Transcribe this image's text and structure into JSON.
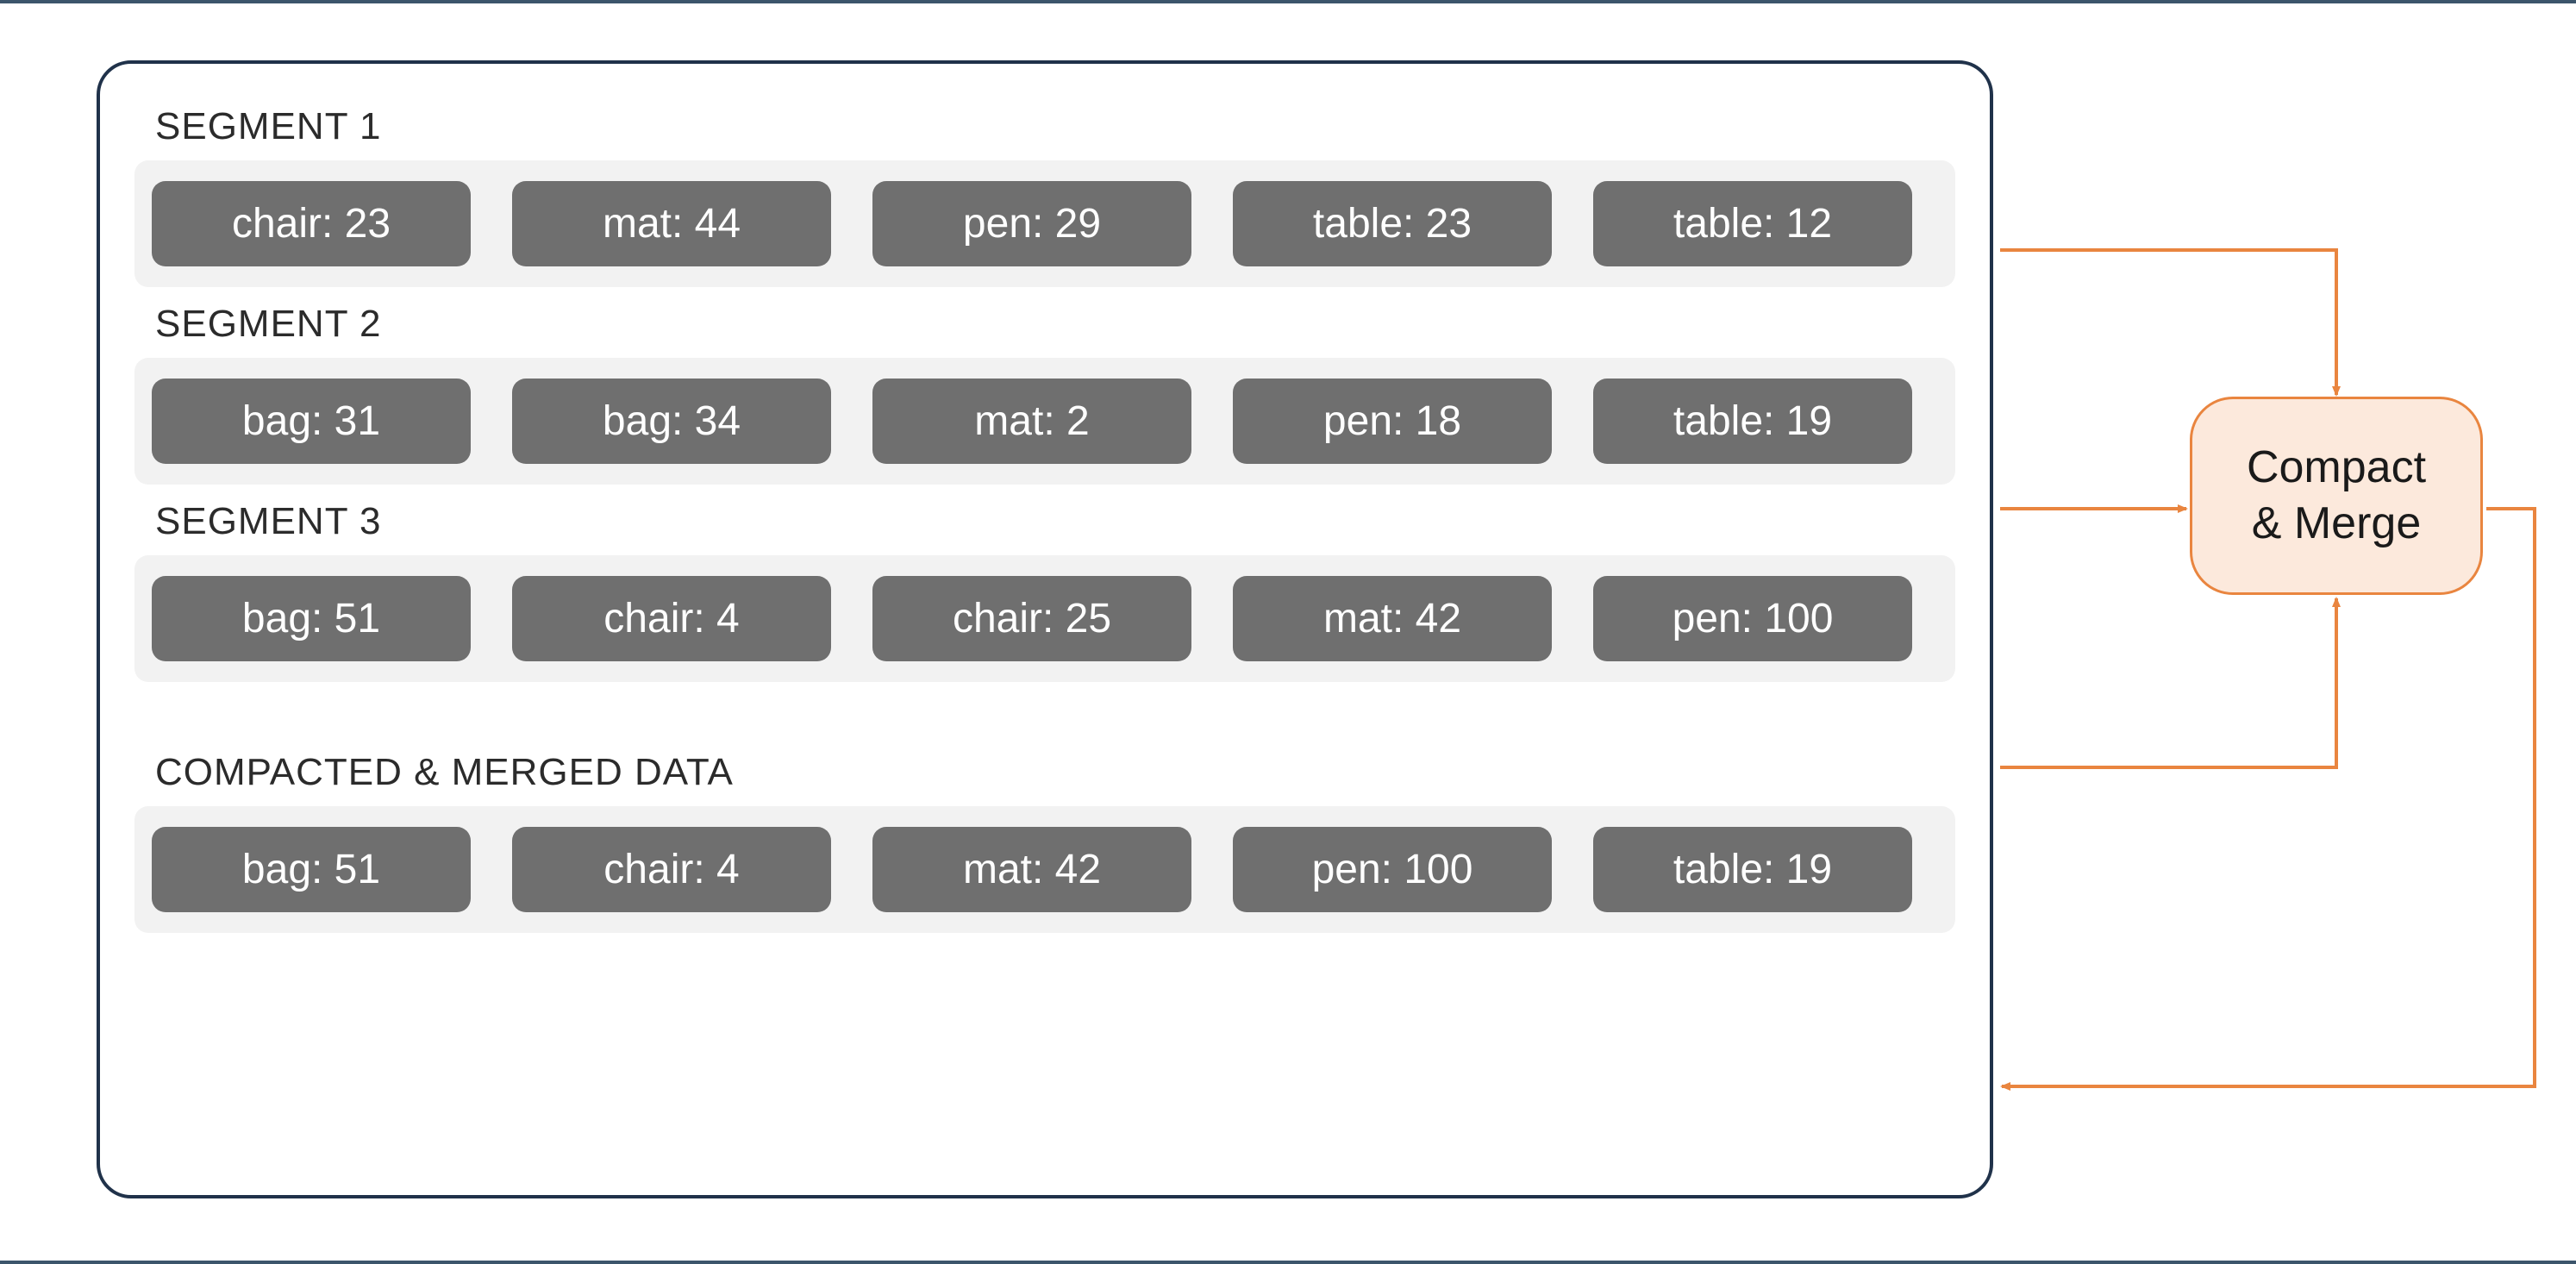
{
  "segments": [
    {
      "title": "SEGMENT 1",
      "items": [
        {
          "label": "chair: 23"
        },
        {
          "label": "mat: 44"
        },
        {
          "label": "pen: 29"
        },
        {
          "label": "table: 23"
        },
        {
          "label": "table: 12"
        }
      ]
    },
    {
      "title": "SEGMENT 2",
      "items": [
        {
          "label": "bag: 31"
        },
        {
          "label": "bag: 34"
        },
        {
          "label": "mat: 2"
        },
        {
          "label": "pen: 18"
        },
        {
          "label": "table: 19"
        }
      ]
    },
    {
      "title": "SEGMENT 3",
      "items": [
        {
          "label": "bag: 51"
        },
        {
          "label": "chair: 4"
        },
        {
          "label": "chair: 25"
        },
        {
          "label": "mat: 42"
        },
        {
          "label": "pen: 100"
        }
      ]
    }
  ],
  "output": {
    "title": "COMPACTED & MERGED DATA",
    "items": [
      {
        "label": "bag: 51"
      },
      {
        "label": "chair: 4"
      },
      {
        "label": "mat: 42"
      },
      {
        "label": "pen: 100"
      },
      {
        "label": "table: 19"
      }
    ]
  },
  "process": {
    "line1": "Compact",
    "line2": "& Merge"
  },
  "colors": {
    "arrow": "#e9853f",
    "chip_bg": "#6f6f6f",
    "chip_fg": "#ffffff",
    "row_bg": "#f2f2f2",
    "panel_border": "#20324a",
    "process_bg": "#fce9dc",
    "process_border": "#e9853f"
  }
}
